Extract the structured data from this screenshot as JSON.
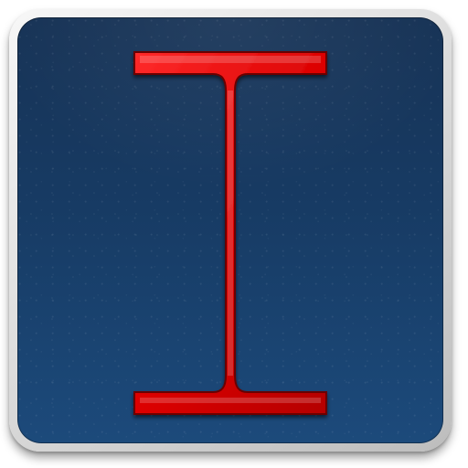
{
  "icon": {
    "letter": "I",
    "glyph_name": "i-beam-icon",
    "colors": {
      "tile_top": "#173356",
      "tile_bottom": "#1c4a7b",
      "bezel_light": "#f7f7f7",
      "bezel_dark": "#bdbdbd",
      "letter_fill": "#d90000",
      "letter_shadow": "#6b0000"
    }
  }
}
